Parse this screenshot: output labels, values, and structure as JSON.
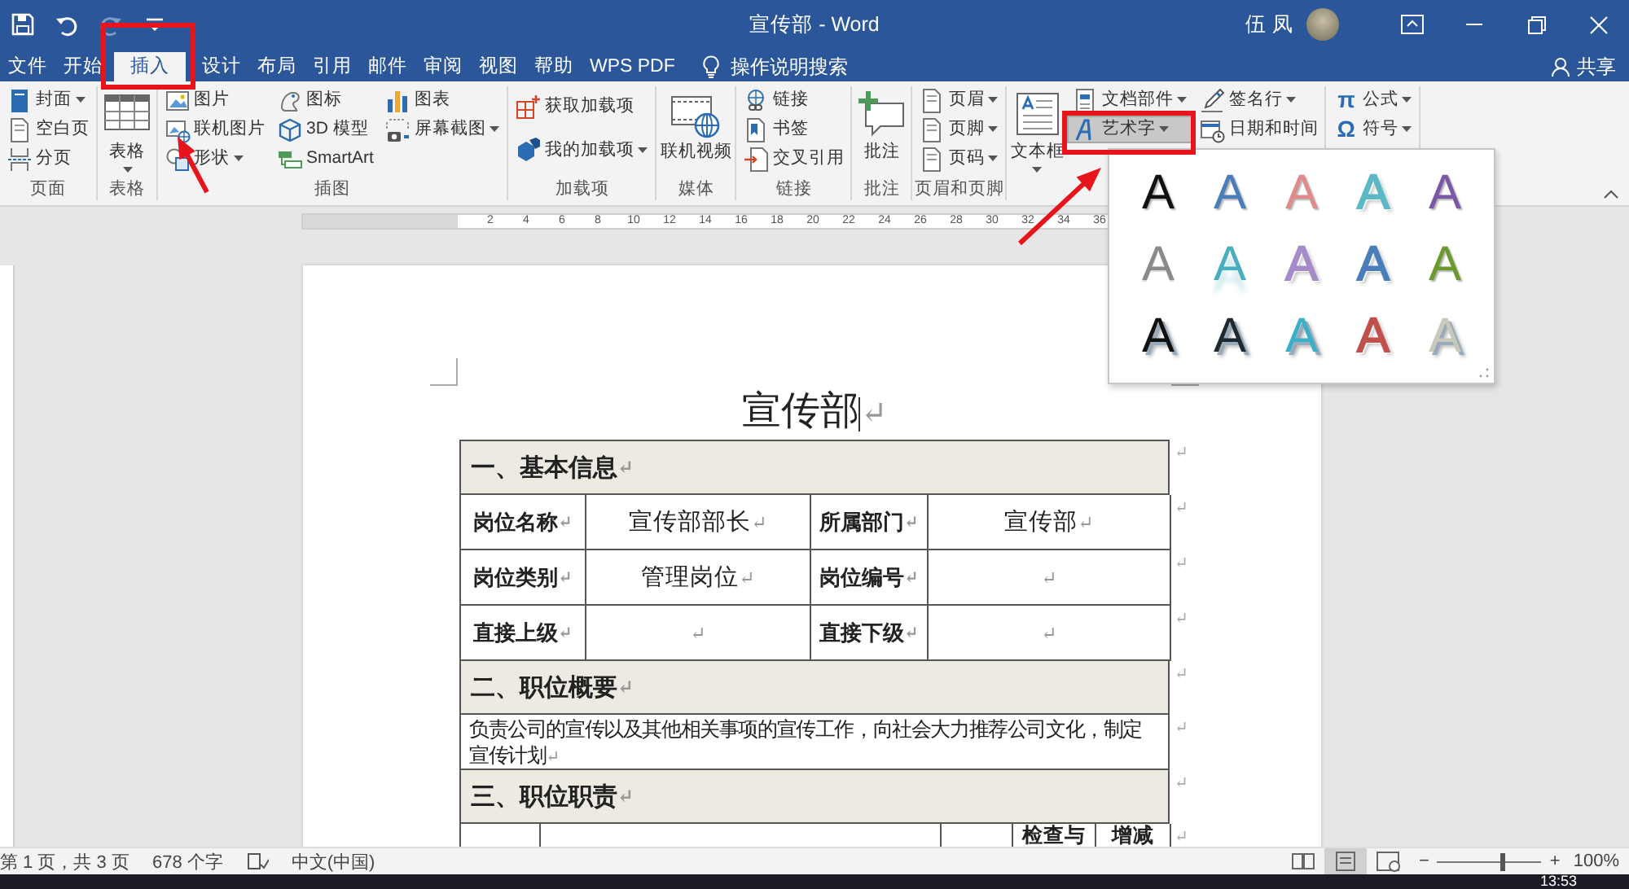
{
  "window": {
    "title": "宣传部 - Word",
    "user": "伍 凤"
  },
  "quick_access": [
    {
      "kind": "save",
      "disabled": false
    },
    {
      "kind": "undo",
      "disabled": false
    },
    {
      "kind": "redo",
      "disabled": true
    },
    {
      "kind": "customize",
      "disabled": false
    }
  ],
  "tabs": [
    {
      "label": "文件",
      "selected": false
    },
    {
      "label": "开始",
      "selected": false
    },
    {
      "label": "插入",
      "selected": true
    },
    {
      "label": "设计",
      "selected": false
    },
    {
      "label": "布局",
      "selected": false
    },
    {
      "label": "引用",
      "selected": false
    },
    {
      "label": "邮件",
      "selected": false
    },
    {
      "label": "审阅",
      "selected": false
    },
    {
      "label": "视图",
      "selected": false
    },
    {
      "label": "帮助",
      "selected": false
    },
    {
      "label": "WPS PDF",
      "selected": false
    }
  ],
  "tell_me": "操作说明搜索",
  "share": "共享",
  "ribbon": {
    "groups": [
      {
        "label": "页面",
        "columns": [
          [
            {
              "kind": "small",
              "label": "封面",
              "dropdown": true,
              "pressed": false
            },
            {
              "kind": "small",
              "label": "空白页",
              "dropdown": false,
              "pressed": false
            },
            {
              "kind": "small",
              "label": "分页",
              "dropdown": false,
              "pressed": false
            }
          ]
        ]
      },
      {
        "label": "表格",
        "columns": [
          [
            {
              "kind": "big",
              "label": "表格",
              "dropdown": true,
              "pressed": false
            }
          ]
        ]
      },
      {
        "label": "插图",
        "columns": [
          [
            {
              "kind": "small",
              "label": "图片",
              "dropdown": false,
              "pressed": false
            },
            {
              "kind": "small",
              "label": "联机图片",
              "dropdown": false,
              "pressed": false
            },
            {
              "kind": "small",
              "label": "形状",
              "dropdown": true,
              "pressed": false
            }
          ],
          [
            {
              "kind": "small",
              "label": "图标",
              "dropdown": false,
              "pressed": false
            },
            {
              "kind": "small",
              "label": "3D 模型",
              "dropdown": false,
              "pressed": false
            },
            {
              "kind": "small",
              "label": "SmartArt",
              "dropdown": false,
              "pressed": false
            }
          ],
          [
            {
              "kind": "small",
              "label": "图表",
              "dropdown": false,
              "pressed": false
            },
            {
              "kind": "small",
              "label": "屏幕截图",
              "dropdown": true,
              "pressed": false
            }
          ]
        ]
      },
      {
        "label": "加载项",
        "columns": [
          [
            {
              "kind": "small",
              "label": "获取加载项",
              "dropdown": false,
              "pressed": false
            },
            {
              "kind": "small",
              "label": "我的加载项",
              "dropdown": true,
              "pressed": false
            }
          ]
        ]
      },
      {
        "label": "媒体",
        "columns": [
          [
            {
              "kind": "big",
              "label": "联机视频",
              "dropdown": false,
              "pressed": false
            }
          ]
        ]
      },
      {
        "label": "链接",
        "columns": [
          [
            {
              "kind": "small",
              "label": "链接",
              "dropdown": false,
              "pressed": false
            },
            {
              "kind": "small",
              "label": "书签",
              "dropdown": false,
              "pressed": false
            },
            {
              "kind": "small",
              "label": "交叉引用",
              "dropdown": false,
              "pressed": false
            }
          ]
        ]
      },
      {
        "label": "批注",
        "columns": [
          [
            {
              "kind": "big",
              "label": "批注",
              "dropdown": false,
              "pressed": false
            }
          ]
        ]
      },
      {
        "label": "页眉和页脚",
        "columns": [
          [
            {
              "kind": "small",
              "label": "页眉",
              "dropdown": true,
              "pressed": false
            },
            {
              "kind": "small",
              "label": "页脚",
              "dropdown": true,
              "pressed": false
            },
            {
              "kind": "small",
              "label": "页码",
              "dropdown": true,
              "pressed": false
            }
          ]
        ]
      },
      {
        "columns": [
          [
            {
              "kind": "big",
              "label": "文本框",
              "dropdown": true,
              "pressed": false
            }
          ],
          [
            {
              "kind": "small",
              "label": "文档部件",
              "dropdown": true,
              "pressed": false
            },
            {
              "kind": "small",
              "label": "艺术字",
              "dropdown": true,
              "pressed": true
            }
          ],
          [
            {
              "kind": "small",
              "label": "签名行",
              "dropdown": true,
              "pressed": false
            },
            {
              "kind": "small",
              "label": "日期和时间",
              "dropdown": false,
              "pressed": false
            }
          ]
        ]
      },
      {
        "columns": [
          [
            {
              "kind": "small",
              "label": "公式",
              "icon_char": "π",
              "dropdown": true,
              "pressed": false
            },
            {
              "kind": "small",
              "label": "符号",
              "icon_char": "Ω",
              "dropdown": true,
              "pressed": false
            }
          ]
        ]
      }
    ]
  },
  "ruler": [
    "2",
    "4",
    "6",
    "8",
    "10",
    "12",
    "14",
    "16",
    "18",
    "20",
    "22",
    "24",
    "26",
    "28",
    "30",
    "32",
    "34",
    "36"
  ],
  "document": {
    "title": {
      "text": "宣传部",
      "mark": "↵"
    },
    "rows": [
      {
        "kind": "section",
        "end_mark": "↵",
        "cells": [
          {
            "text": "一、基本信息",
            "mark": "↵"
          }
        ]
      },
      {
        "kind": "fields",
        "end_mark": "↵",
        "cells": [
          {
            "text": "岗位名称",
            "mark": "↵"
          },
          {
            "text": "宣传部部长",
            "mark": "↵"
          },
          {
            "text": "所属部门",
            "mark": "↵"
          },
          {
            "text": "宣传部",
            "mark": "↵"
          }
        ]
      },
      {
        "kind": "fields",
        "end_mark": "↵",
        "cells": [
          {
            "text": "岗位类别",
            "mark": "↵"
          },
          {
            "text": "管理岗位",
            "mark": "↵"
          },
          {
            "text": "岗位编号",
            "mark": "↵"
          },
          {
            "mark": "↵"
          }
        ]
      },
      {
        "kind": "fields",
        "end_mark": "↵",
        "cells": [
          {
            "text": "直接上级",
            "mark": "↵"
          },
          {
            "mark": "↵"
          },
          {
            "text": "直接下级",
            "mark": "↵"
          },
          {
            "mark": "↵"
          }
        ]
      },
      {
        "kind": "section",
        "end_mark": "↵",
        "cells": [
          {
            "text": "二、职位概要",
            "mark": "↵"
          }
        ]
      },
      {
        "kind": "paragraph",
        "end_mark": "↵",
        "cells": [
          {
            "text": "负责公司的宣传以及其他相关事项的宣传工作，向社会大力推荐公司文化，制定宣传计划",
            "mark": "↵"
          }
        ]
      },
      {
        "kind": "section",
        "end_mark": "↵",
        "cells": [
          {
            "text": "三、职位职责",
            "mark": "↵"
          }
        ]
      },
      {
        "kind": "duties",
        "end_mark": "↵",
        "cells": [
          {
            "text": "检查与"
          },
          {
            "text": "增减"
          }
        ]
      }
    ]
  },
  "wordart": {
    "styles": [
      {
        "letter": "A",
        "kind": "fill",
        "color": "#111111"
      },
      {
        "letter": "A",
        "kind": "fill",
        "color": "#4a7ebb"
      },
      {
        "letter": "A",
        "kind": "fill",
        "color": "#e08a8a"
      },
      {
        "letter": "A",
        "kind": "outline",
        "color": "#5bb8c7"
      },
      {
        "letter": "A",
        "kind": "fill",
        "color": "#7b57a6"
      },
      {
        "letter": "A",
        "kind": "gradient",
        "color": "#8a8a8a"
      },
      {
        "letter": "A",
        "kind": "reflect",
        "color": "#4aaebf"
      },
      {
        "letter": "A",
        "kind": "outline",
        "color": "#a58cc8"
      },
      {
        "letter": "A",
        "kind": "outline",
        "color": "#4a7ebb"
      },
      {
        "letter": "A",
        "kind": "fill",
        "color": "#6a9a2c"
      },
      {
        "letter": "A",
        "kind": "shadow",
        "color": "#111111"
      },
      {
        "letter": "A",
        "kind": "shadow",
        "color": "#1f2a30"
      },
      {
        "letter": "A",
        "kind": "shadow",
        "color": "#3ab0c8"
      },
      {
        "letter": "A",
        "kind": "outline",
        "color": "#c0504d"
      },
      {
        "letter": "A",
        "kind": "shadow",
        "color": "#c8c8bc"
      }
    ]
  },
  "statusbar": {
    "page": "第 1 页，共 3 页",
    "words": "678 个字",
    "language": "中文(中国)",
    "views": [
      {
        "kind": "read",
        "selected": false
      },
      {
        "kind": "print",
        "selected": true
      },
      {
        "kind": "web",
        "selected": false
      }
    ],
    "zoom": {
      "minus": "−",
      "plus": "+",
      "level": 0.62,
      "reading": "100%"
    }
  },
  "taskbar": {
    "time": "13:53"
  }
}
